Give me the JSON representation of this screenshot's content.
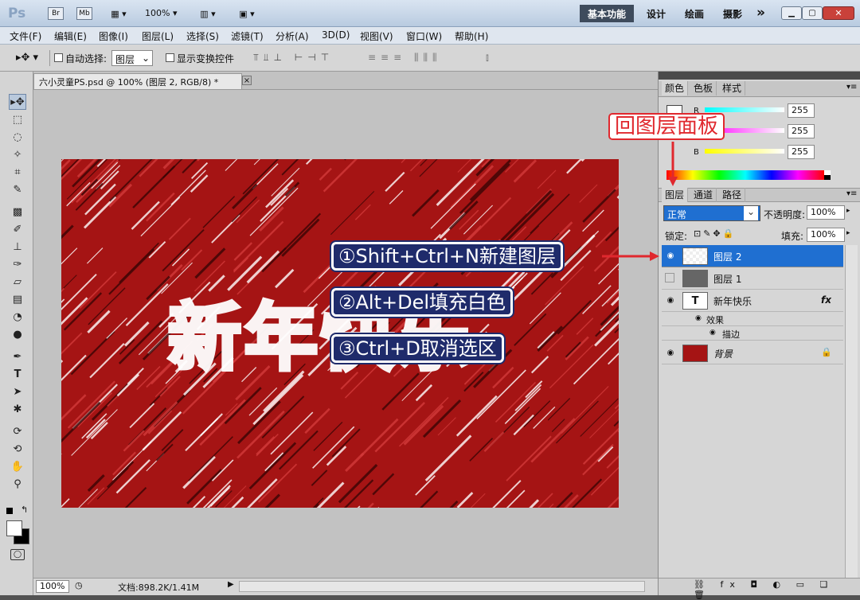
{
  "app": {
    "logo": "Ps",
    "bridge": "Br",
    "minibridge": "Mb",
    "zoom": "100%",
    "workspaces": [
      "基本功能",
      "设计",
      "绘画",
      "摄影"
    ],
    "more": "»"
  },
  "menu": [
    "文件(F)",
    "编辑(E)",
    "图像(I)",
    "图层(L)",
    "选择(S)",
    "滤镜(T)",
    "分析(A)",
    "3D(D)",
    "视图(V)",
    "窗口(W)",
    "帮助(H)"
  ],
  "options": {
    "auto_select_label": "自动选择:",
    "auto_select_value": "图层",
    "show_transform_label": "显示变换控件"
  },
  "document_tab": {
    "title": "六小灵童PS.psd @ 100% (图层 2, RGB/8) *",
    "close": "×"
  },
  "status": {
    "zoom": "100%",
    "doc_info": "文档:898.2K/1.41M"
  },
  "color_panel": {
    "tabs": [
      "颜色",
      "色板",
      "样式"
    ],
    "channels": [
      {
        "label": "R",
        "value": "255"
      },
      {
        "label": "G",
        "value": "255"
      },
      {
        "label": "B",
        "value": "255"
      }
    ]
  },
  "layers_panel": {
    "tabs": [
      "图层",
      "通道",
      "路径"
    ],
    "blend_mode": "正常",
    "opacity_label": "不透明度:",
    "opacity_value": "100%",
    "lock_label": "锁定:",
    "fill_label": "填充:",
    "fill_value": "100%",
    "layers": [
      {
        "name": "图层 2",
        "selected": true,
        "visible": true
      },
      {
        "name": "图层 1",
        "selected": false,
        "visible": false
      },
      {
        "name": "新年快乐",
        "selected": false,
        "visible": true,
        "type": "T",
        "fx": "fx"
      },
      {
        "name": "效果",
        "sub": true
      },
      {
        "name": "描边",
        "sub": true
      },
      {
        "name": "背景",
        "selected": false,
        "visible": true,
        "locked": true
      }
    ]
  },
  "annotations": {
    "panel_callout": "回图层面板",
    "step1": "①Shift+Ctrl+N新建图层",
    "step2": "②Alt+Del填充白色",
    "step3": "③Ctrl+D取消选区"
  },
  "canvas": {
    "text": "新年快乐",
    "bg_color": "#a51414"
  },
  "colors": {
    "accent": "#1f6fd1",
    "annotation_bg": "#1f2b6b",
    "callout_red": "#e0282e"
  }
}
